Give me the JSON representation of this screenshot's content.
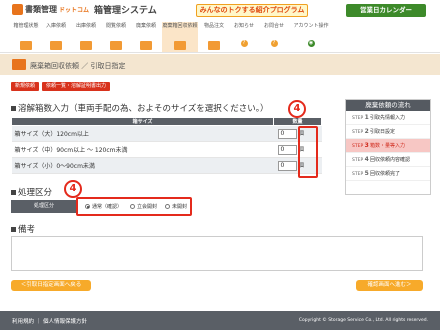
{
  "header": {
    "logo_main": "書類管理",
    "logo_sub": "ドットコム",
    "system_title": "箱管理システム",
    "promo_text": "みんなのトクする紹介プログラム",
    "calendar_button": "営業日カレンダー"
  },
  "nav": [
    {
      "label": "箱管理状態",
      "icon": "box-icon"
    },
    {
      "label": "入庫依頼",
      "icon": "box-icon"
    },
    {
      "label": "出庫依頼",
      "icon": "box-icon"
    },
    {
      "label": "閲覧依頼",
      "icon": "box-icon"
    },
    {
      "label": "廃棄依頼",
      "icon": "box-icon"
    },
    {
      "label": "廃棄箱回収依頼",
      "icon": "box-icon"
    },
    {
      "label": "物品注文",
      "icon": "box-icon"
    },
    {
      "label": "お知らせ",
      "icon": "info-icon"
    },
    {
      "label": "お問合せ",
      "icon": "info-icon"
    },
    {
      "label": "アカウント操作",
      "icon": "account-icon"
    }
  ],
  "page": {
    "title_path": "廃棄箱回収依頼",
    "title_current": "引取日指定"
  },
  "crumbs": [
    "新規依頼",
    "依頼一覧・溶解証明書出力"
  ],
  "boxes": {
    "section_title": "溶解箱数入力（車両手配の為、およそのサイズを選択ください。）",
    "col_size": "箱サイズ",
    "col_qty": "数量",
    "unit": "個",
    "rows": [
      {
        "name": "箱サイズ（大）120cm以上",
        "qty": "0"
      },
      {
        "name": "箱サイズ（中）90cm以上 ～ 120cm未満",
        "qty": "0"
      },
      {
        "name": "箱サイズ（小）0～90cm未満",
        "qty": "0"
      }
    ]
  },
  "flow": {
    "title": "廃棄依頼の流れ",
    "steps": [
      {
        "step": "1",
        "label": "引取先情報入力"
      },
      {
        "step": "2",
        "label": "引取日設定"
      },
      {
        "step": "3",
        "label": "箱数・量等入力"
      },
      {
        "step": "4",
        "label": "回収依頼内容確認"
      },
      {
        "step": "5",
        "label": "回収依頼完了"
      }
    ],
    "current": "3",
    "step_prefix": "STEP"
  },
  "processing": {
    "section_title": "処理区分",
    "label": "処理区分",
    "options": [
      "通常（確認）",
      "立会開封",
      "未開封"
    ],
    "selected": "通常（確認）"
  },
  "remarks": {
    "section_title": "備考",
    "value": ""
  },
  "annotations": {
    "marker": "4"
  },
  "buttons": {
    "back": "＜引取日指定画面へ戻る",
    "next": "確認画面へ進む＞"
  },
  "footer": {
    "link_terms": "利用規約",
    "link_privacy": "個人情報保護方針",
    "copyright": "Copyright © Storage Service Co., Ltd. All rights reserved."
  },
  "colors": {
    "accent": "#e8741c",
    "marker": "#e42a1c",
    "header_bar": "#5a5f66"
  }
}
